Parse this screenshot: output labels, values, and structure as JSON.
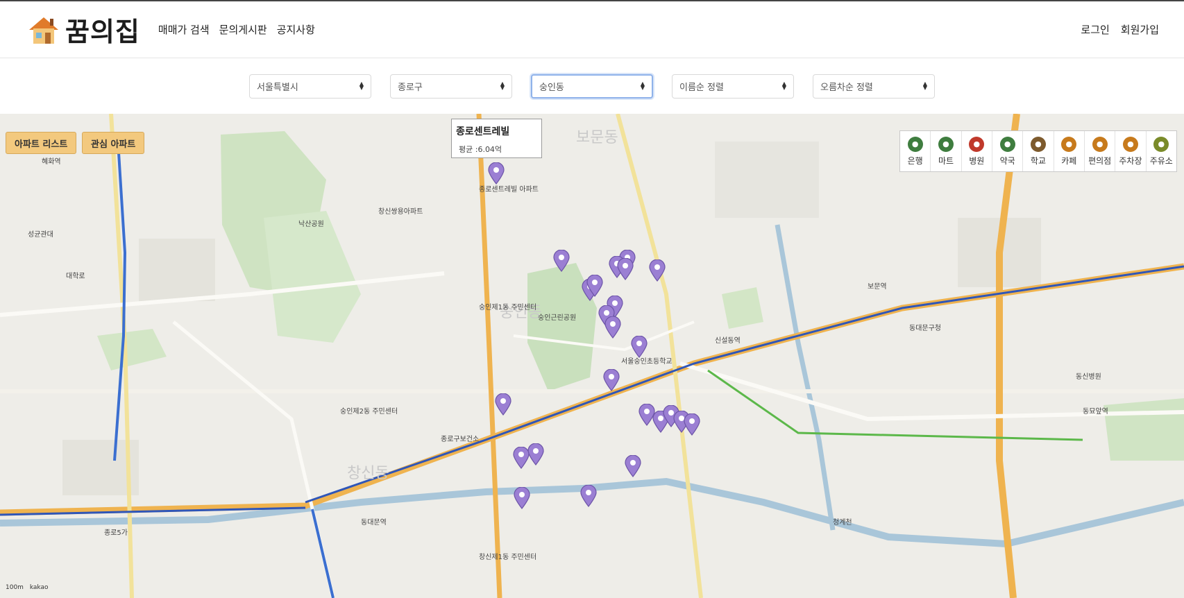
{
  "header": {
    "logo_text": "꿈의집",
    "nav": [
      "매매가 검색",
      "문의게시판",
      "공지사항"
    ],
    "login": "로그인",
    "signup": "회원가입"
  },
  "filters": {
    "city": "서울특별시",
    "district": "종로구",
    "dong": "숭인동",
    "sort_name": "이름순 정렬",
    "sort_order": "오름차순 정렬"
  },
  "map": {
    "btn_apt_list": "아파트 리스트",
    "btn_fav_apt": "관심 아파트",
    "popup": {
      "title": "종로센트레빌",
      "avg": "평균 :6.04억"
    },
    "categories": [
      {
        "label": "은행",
        "color": "#3f7d3f"
      },
      {
        "label": "마트",
        "color": "#3f7d3f"
      },
      {
        "label": "병원",
        "color": "#c0392b"
      },
      {
        "label": "약국",
        "color": "#3f7d3f"
      },
      {
        "label": "학교",
        "color": "#7d5a2d"
      },
      {
        "label": "카페",
        "color": "#c77a1c"
      },
      {
        "label": "편의점",
        "color": "#c77a1c"
      },
      {
        "label": "주차장",
        "color": "#c77a1c"
      },
      {
        "label": "주유소",
        "color": "#7a8b2a"
      }
    ],
    "districts": [
      "보문동",
      "숭인동",
      "창신동"
    ],
    "labels": [
      "혜화역",
      "성균관대",
      "대학로",
      "창신쌍용아파트",
      "숭인근린공원",
      "신설동역",
      "보문역",
      "동묘앞역",
      "종로5가",
      "동대문역",
      "종로센트레빌 아파트",
      "창신제1동 주민센터",
      "숭인제1동 주민센터",
      "동대문구청",
      "서울숭인초등학교",
      "종로구보건소",
      "청계천",
      "낙산공원",
      "숭인제2동 주민센터",
      "동신병원"
    ],
    "scale": "100m",
    "provider": "kakao"
  }
}
